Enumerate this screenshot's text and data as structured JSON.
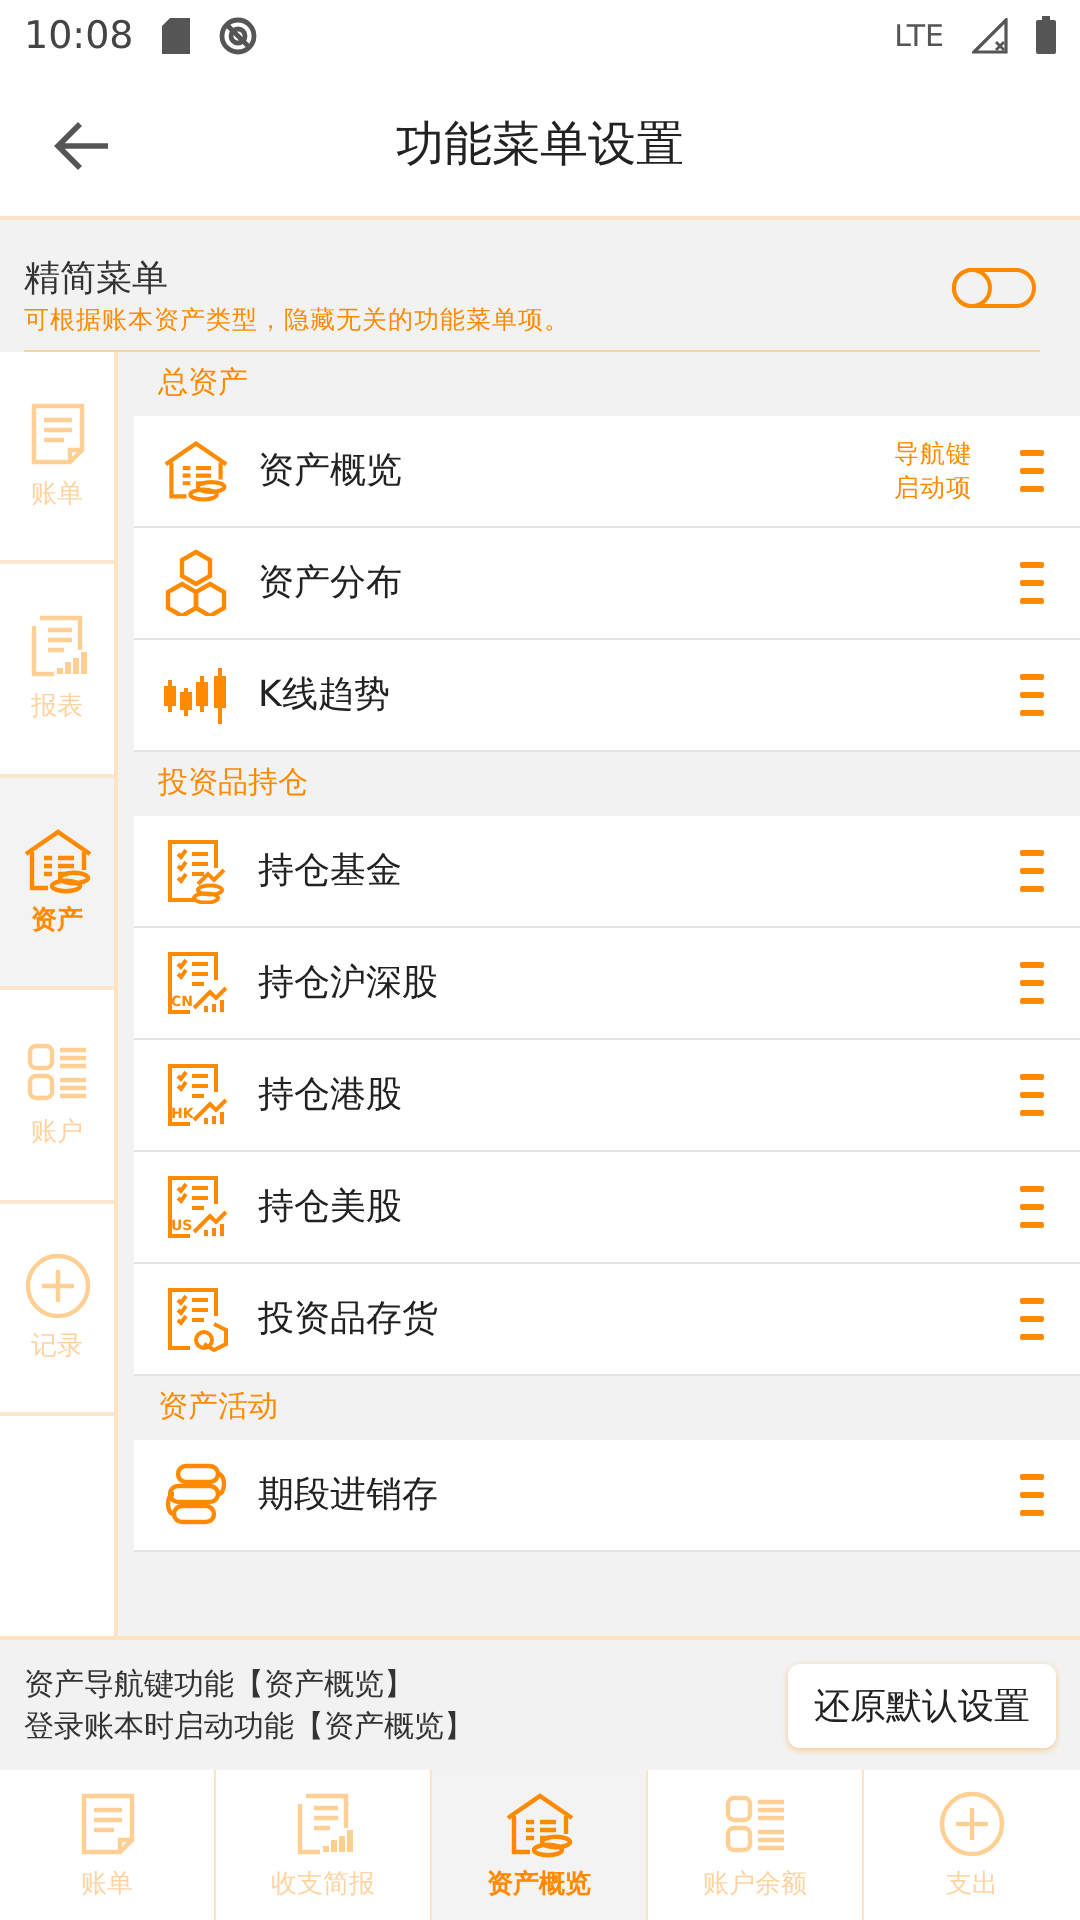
{
  "status_bar": {
    "time": "10:08",
    "network": "LTE"
  },
  "app_bar": {
    "title": "功能菜单设置"
  },
  "simple_menu": {
    "title": "精简菜单",
    "description": "可根据账本资产类型，隐藏无关的功能菜单项。",
    "on": false
  },
  "sidebar": {
    "items": [
      {
        "label": "账单",
        "selected": false
      },
      {
        "label": "报表",
        "selected": false
      },
      {
        "label": "资产",
        "selected": true
      },
      {
        "label": "账户",
        "selected": false
      },
      {
        "label": "记录",
        "selected": false
      }
    ]
  },
  "sections": [
    {
      "title": "总资产",
      "items": [
        {
          "label": "资产概览",
          "tag_lines": [
            "导航键",
            "启动项"
          ]
        },
        {
          "label": "资产分布"
        },
        {
          "label": "K线趋势"
        }
      ]
    },
    {
      "title": "投资品持仓",
      "items": [
        {
          "label": "持仓基金"
        },
        {
          "label": "持仓沪深股",
          "icon_label": "CN"
        },
        {
          "label": "持仓港股",
          "icon_label": "HK"
        },
        {
          "label": "持仓美股",
          "icon_label": "US"
        },
        {
          "label": "投资品存货"
        }
      ]
    },
    {
      "title": "资产活动",
      "items": [
        {
          "label": "期段进销存"
        }
      ]
    }
  ],
  "footer": {
    "lines": [
      "资产导航键功能【资产概览】",
      "登录账本时启动功能【资产概览】"
    ],
    "button": "还原默认设置"
  },
  "bottom_nav": [
    {
      "label": "账单",
      "selected": false
    },
    {
      "label": "收支简报",
      "selected": false
    },
    {
      "label": "资产概览",
      "selected": true
    },
    {
      "label": "账户余额",
      "selected": false
    },
    {
      "label": "支出",
      "selected": false
    }
  ]
}
